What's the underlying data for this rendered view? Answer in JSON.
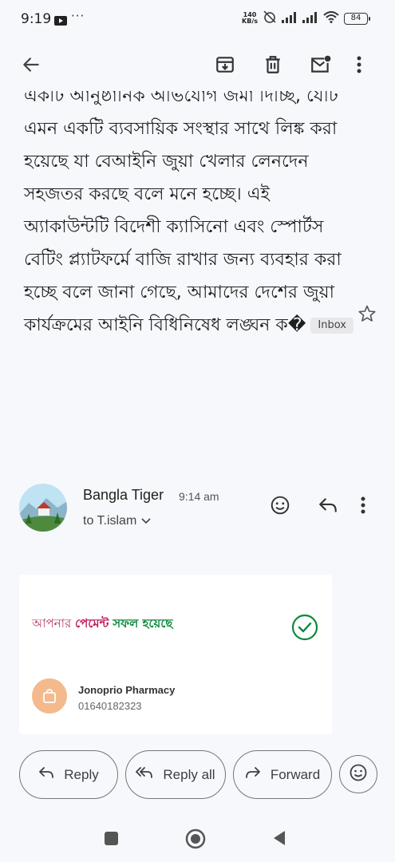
{
  "status_bar": {
    "time": "9:19",
    "dots": "···",
    "speed_top": "140",
    "speed_bottom": "KB/s",
    "battery": "84"
  },
  "message": {
    "body": "একটি আনুষ্ঠানিক অভিযোগ জমা দিচ্ছি, যেটি এমন একটি ব্যবসায়িক সংস্থার সাথে লিঙ্ক করা হয়েছে যা বেআইনি জুয়া খেলার লেনদেন সহজতর করছে বলে মনে হচ্ছে। এই অ্যাকাউন্টটি বিদেশী ক্যাসিনো এবং স্পোর্টস বেটিং প্ল্যাটফর্মে বাজি রাখার জন্য ব্যবহার করা হচ্ছে বলে জানা গেছে, আমাদের দেশের জুয়া কার্যক্রমের আইনি বিধিনিষেধ লঙ্ঘন ক�",
    "label": "Inbox"
  },
  "sender": {
    "name": "Bangla Tiger",
    "time": "9:14 am",
    "recipient": "to T.islam"
  },
  "card": {
    "title_w1": "আপনার",
    "title_w2": "পেমেন্ট",
    "title_w3": "সফল হয়েছে",
    "merchant": "Jonoprio Pharmacy",
    "phone": "01640182323"
  },
  "actions": {
    "reply": "Reply",
    "reply_all": "Reply all",
    "forward": "Forward"
  },
  "colors": {
    "accent_green": "#0a8a3a",
    "pink": "#c2185b",
    "merchant_badge": "#f4b98c"
  }
}
